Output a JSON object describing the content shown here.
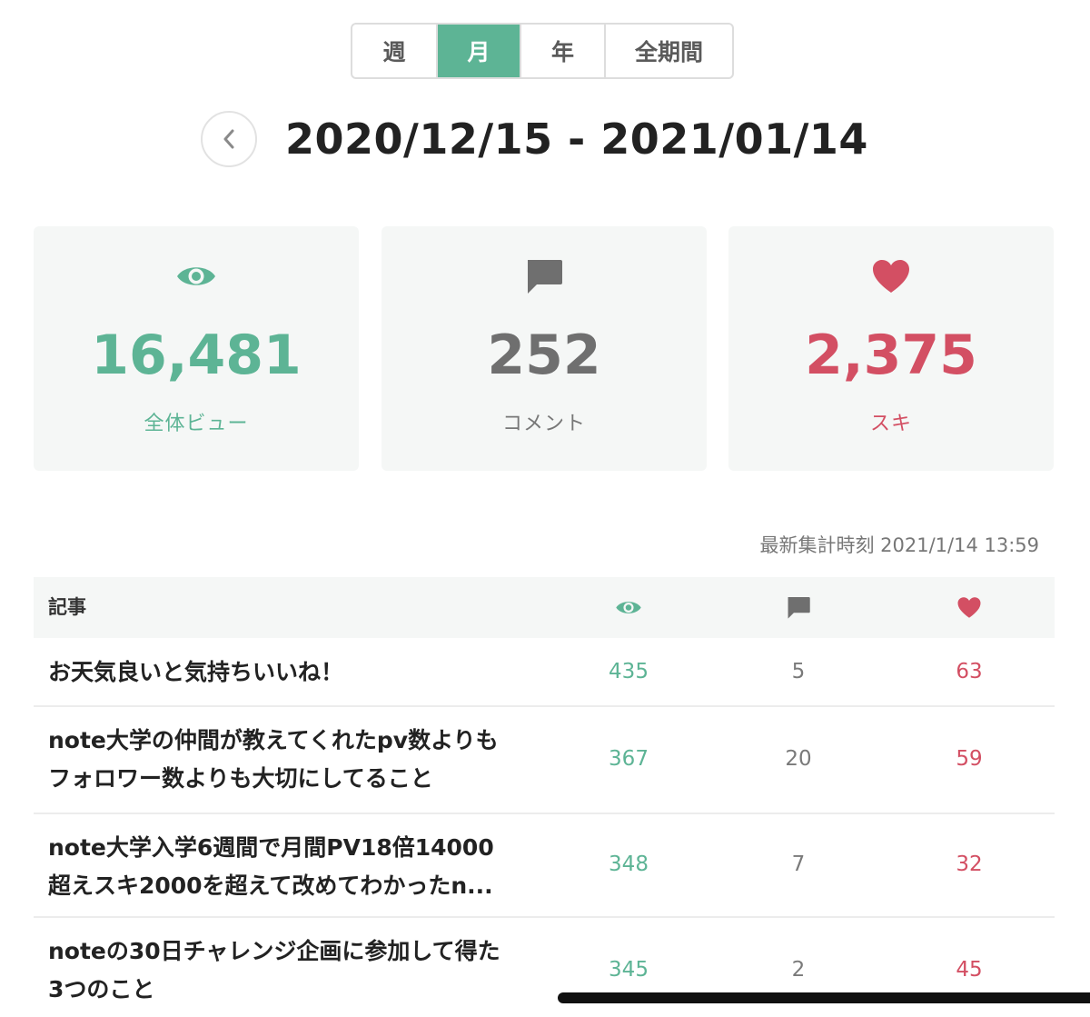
{
  "period_tabs": {
    "week": "週",
    "month": "月",
    "year": "年",
    "all": "全期間",
    "selected": "月"
  },
  "date_range": "2020/12/15 - 2021/01/14",
  "stats": {
    "views": {
      "value": "16,481",
      "label": "全体ビュー",
      "icon": "eye-icon",
      "color": "#5db495"
    },
    "comments": {
      "value": "252",
      "label": "コメント",
      "icon": "comment-icon",
      "color": "#777777"
    },
    "likes": {
      "value": "2,375",
      "label": "スキ",
      "icon": "heart-icon",
      "color": "#d34f63"
    }
  },
  "updated_at": "最新集計時刻 2021/1/14 13:59",
  "table": {
    "header": {
      "title": "記事"
    },
    "rows": [
      {
        "title_lines": [
          "お天気良いと気持ちいいね！"
        ],
        "views": "435",
        "comments": "5",
        "likes": "63"
      },
      {
        "title_lines": [
          "note大学の仲間が教えてくれたpv数よりも",
          "フォロワー数よりも大切にしてること"
        ],
        "views": "367",
        "comments": "20",
        "likes": "59"
      },
      {
        "title_lines": [
          "note大学入学6週間で月間PV18倍14000",
          "超えスキ2000を超えて改めてわかったn..."
        ],
        "views": "348",
        "comments": "7",
        "likes": "32"
      },
      {
        "title_lines": [
          "noteの30日チャレンジ企画に参加して得た",
          "3つのこと"
        ],
        "views": "345",
        "comments": "2",
        "likes": "45"
      }
    ]
  },
  "colors": {
    "accent": "#5db495",
    "like": "#d34f63",
    "comment": "#777777"
  }
}
